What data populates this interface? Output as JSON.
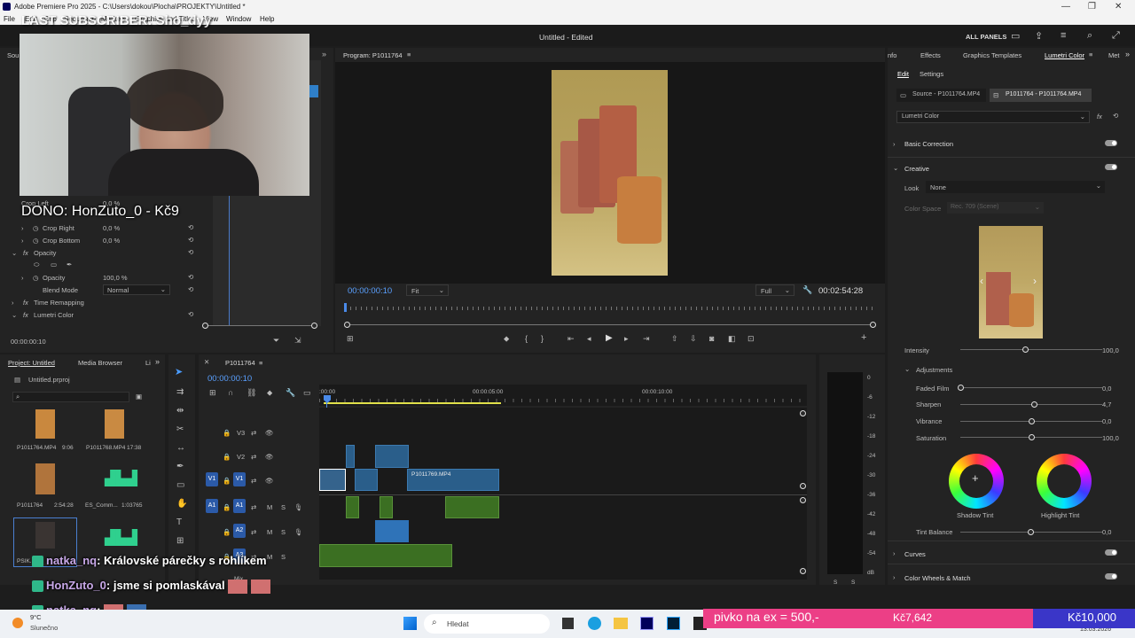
{
  "titlebar": {
    "title": "Adobe Premiere Pro 2025 - C:\\Users\\dokou\\Plocha\\PROJEKTY\\Untitled *"
  },
  "menu": [
    "File",
    "Edit",
    "Clip",
    "Sequence",
    "Markers",
    "Graphics and Titles",
    "View",
    "Window",
    "Help"
  ],
  "header": {
    "doc_title": "Untitled - Edited",
    "all_panels": "ALL PANELS"
  },
  "overlay": {
    "last_sub": "LAST SUBSCRIBER: Sho_dyy",
    "donation": "DONO: HonZuto_0 - Kč9"
  },
  "source_panel": {
    "tab": "Sou",
    "rows": [
      {
        "label": "Crop Left",
        "value": "0,0 %"
      },
      {
        "label": "Crop Right",
        "value": "0,0 %"
      },
      {
        "label": "Crop Bottom",
        "value": "0,0 %"
      }
    ],
    "opacity_label": "Opacity",
    "opacity_value_label": "Opacity",
    "opacity_value": "100,0 %",
    "blend_label": "Blend Mode",
    "blend_value": "Normal",
    "time_remap": "Time Remapping",
    "lumetri": "Lumetri Color",
    "timecode": "00:00:00:10"
  },
  "program": {
    "title": "Program: P1011764",
    "timecode": "00:00:00:10",
    "fit": "Fit",
    "full": "Full",
    "duration": "00:02:54:28"
  },
  "project": {
    "tab": "Project: Untitled",
    "tab2": "Media Browser",
    "tab3": "Li",
    "file": "Untitled.prproj",
    "items": [
      {
        "name": "P1011764.MP4",
        "dur": "9:06"
      },
      {
        "name": "P1011768.MP4",
        "dur": "17:38"
      },
      {
        "name": "P1011764",
        "dur": "2:54:28"
      },
      {
        "name": "ES_Comm...",
        "dur": "1:03765"
      },
      {
        "name": "PSIK.mp",
        "dur": ""
      },
      {
        "name": "",
        "dur": ""
      }
    ]
  },
  "timeline": {
    "tab": "P1011764",
    "timecode": "00:00:00:10",
    "ruler": [
      ":00:00",
      "00:00:05:00",
      "00:00:10:00"
    ],
    "tracks": [
      "V3",
      "V2",
      "V1",
      "A1",
      "A2",
      "A3"
    ],
    "clip_label": "P1011769.MP4",
    "mix": "Mix"
  },
  "meter": {
    "ticks": [
      "0",
      "-6",
      "-12",
      "-18",
      "-24",
      "-30",
      "-36",
      "-42",
      "-48",
      "-54"
    ],
    "db": "dB",
    "s1": "S",
    "s2": "S"
  },
  "lumetri": {
    "tabs": [
      "Info",
      "Effects",
      "Graphics Templates",
      "Lumetri Color",
      "Met"
    ],
    "tabs_display": [
      "nfo",
      "Effects",
      "Graphics Templates",
      "Lumetri Color",
      "Met"
    ],
    "subtabs": [
      "Edit",
      "Settings"
    ],
    "source_btn": "Source - P1011764.MP4",
    "seq_btn": "P1011764 - P1011764.MP4",
    "effect": "Lumetri Color",
    "basic": "Basic Correction",
    "creative": "Creative",
    "look_label": "Look",
    "look_value": "None",
    "colorspace_label": "Color Space",
    "colorspace_value": "Rec. 709 (Scene)",
    "intensity_label": "Intensity",
    "intensity_value": "100,0",
    "adjustments": "Adjustments",
    "sliders": [
      {
        "label": "Faded Film",
        "value": "0,0",
        "level": 0
      },
      {
        "label": "Sharpen",
        "value": "4,7",
        "level": 0.52
      },
      {
        "label": "Vibrance",
        "value": "0,0",
        "level": 0.5
      },
      {
        "label": "Saturation",
        "value": "100,0",
        "level": 0.5
      }
    ],
    "shadow_tint": "Shadow Tint",
    "highlight_tint": "Highlight Tint",
    "tint_balance": "Tint Balance",
    "tint_value": "0,0",
    "curves": "Curves",
    "wheels": "Color Wheels & Match"
  },
  "chat": [
    {
      "user": "natka_nq",
      "msg": ": Královské párečky s rohlíkem"
    },
    {
      "user": "HonZuto_0",
      "msg": ": jsme si pomlaskával"
    },
    {
      "user": "natka_nq",
      "msg": ":"
    }
  ],
  "goal": {
    "text": "pivko na ex = 500,-",
    "current": "Kč7,642",
    "target": "Kč10,000",
    "progress": 0.7642
  },
  "taskbar": {
    "temp": "9°C",
    "weather": "Slunečno",
    "search": "Hledat",
    "date": "13.03.2026"
  }
}
